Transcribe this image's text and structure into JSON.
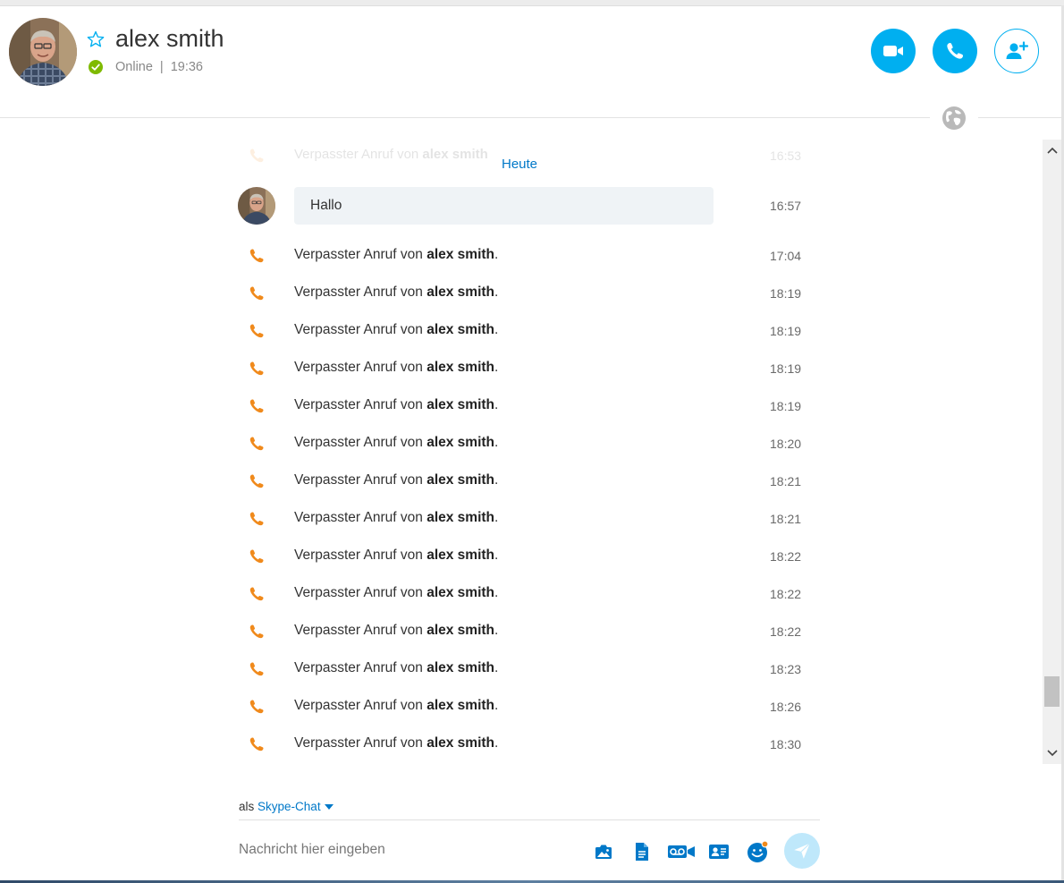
{
  "contact": {
    "name": "alex smith",
    "status": "Online",
    "separator": "|",
    "local_time": "19:36"
  },
  "colors": {
    "accent": "#00aff0",
    "link": "#0078c8",
    "missed_call": "#f08a1c",
    "online": "#7fba00"
  },
  "icons": {
    "favorite": "star-icon",
    "video": "video-camera-icon",
    "call": "phone-icon",
    "add_people": "add-person-icon",
    "globe": "globe-icon",
    "missed_call": "missed-call-phone-icon"
  },
  "chat": {
    "ghost_text": "Verpasster Anruf von",
    "ghost_name": "alex smith",
    "ghost_time": "16:53",
    "date_label": "Heute",
    "message": {
      "text": "Hallo",
      "time": "16:57"
    },
    "missed_calls": [
      {
        "prefix": "Verpasster Anruf von",
        "name": "alex smith",
        "suffix": ".",
        "time": "17:04"
      },
      {
        "prefix": "Verpasster Anruf von",
        "name": "alex smith",
        "suffix": ".",
        "time": "18:19"
      },
      {
        "prefix": "Verpasster Anruf von",
        "name": "alex smith",
        "suffix": ".",
        "time": "18:19"
      },
      {
        "prefix": "Verpasster Anruf von",
        "name": "alex smith",
        "suffix": ".",
        "time": "18:19"
      },
      {
        "prefix": "Verpasster Anruf von",
        "name": "alex smith",
        "suffix": ".",
        "time": "18:19"
      },
      {
        "prefix": "Verpasster Anruf von",
        "name": "alex smith",
        "suffix": ".",
        "time": "18:20"
      },
      {
        "prefix": "Verpasster Anruf von",
        "name": "alex smith",
        "suffix": ".",
        "time": "18:21"
      },
      {
        "prefix": "Verpasster Anruf von",
        "name": "alex smith",
        "suffix": ".",
        "time": "18:21"
      },
      {
        "prefix": "Verpasster Anruf von",
        "name": "alex smith",
        "suffix": ".",
        "time": "18:22"
      },
      {
        "prefix": "Verpasster Anruf von",
        "name": "alex smith",
        "suffix": ".",
        "time": "18:22"
      },
      {
        "prefix": "Verpasster Anruf von",
        "name": "alex smith",
        "suffix": ".",
        "time": "18:22"
      },
      {
        "prefix": "Verpasster Anruf von",
        "name": "alex smith",
        "suffix": ".",
        "time": "18:23"
      },
      {
        "prefix": "Verpasster Anruf von",
        "name": "alex smith",
        "suffix": ".",
        "time": "18:26"
      },
      {
        "prefix": "Verpasster Anruf von",
        "name": "alex smith",
        "suffix": ".",
        "time": "18:30"
      }
    ]
  },
  "composer": {
    "mode_prefix": "als",
    "mode_value": "Skype-Chat",
    "placeholder": "Nachricht hier eingeben",
    "tools": [
      "send-image-icon",
      "send-file-icon",
      "video-message-icon",
      "send-contact-icon",
      "emoticon-icon",
      "send-icon"
    ]
  }
}
